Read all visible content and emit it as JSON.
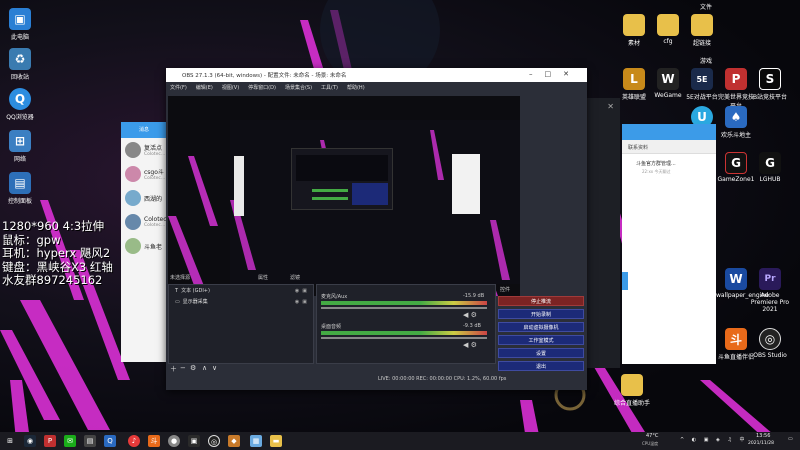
{
  "desktop_left": [
    {
      "label": "此电脑",
      "color": "#2a7fd4",
      "glyph": "▣"
    },
    {
      "label": "回收站",
      "color": "#3a7bb0",
      "glyph": "♻"
    },
    {
      "label": "QQ浏览器",
      "color": "#2c8de0",
      "glyph": "Q"
    },
    {
      "label": "网络",
      "color": "#3b7fc2",
      "glyph": "⊞"
    },
    {
      "label": "控制面板",
      "color": "#2d6fb8",
      "glyph": "▤"
    }
  ],
  "desktop_right_top": [
    {
      "label": "文件",
      "color": "#e8c04a",
      "glyph": "▬"
    },
    {
      "label": "素材",
      "color": "#e8c04a",
      "glyph": "▬"
    },
    {
      "label": "cfg",
      "color": "#e8c04a",
      "glyph": "▬"
    },
    {
      "label": "超链接",
      "color": "#e8c04a",
      "glyph": "▬"
    }
  ],
  "desktop_right_mid": [
    {
      "label": "游戏",
      "color": "#e8c04a",
      "glyph": "▬"
    },
    {
      "label": "英雄联盟",
      "color": "#c88a1a",
      "glyph": "L"
    },
    {
      "label": "WeGame",
      "color": "#222",
      "glyph": "W"
    },
    {
      "label": "5E对战平台",
      "color": "#1a2a4a",
      "glyph": "5E"
    },
    {
      "label": "完美世界竞技平台",
      "color": "#c03030",
      "glyph": "P"
    },
    {
      "label": "B站竞技平台",
      "color": "#0a0a0a",
      "glyph": "S"
    },
    {
      "label": "UU加速器",
      "color": "#2aa8e0",
      "glyph": "U"
    },
    {
      "label": "Steam",
      "color": "#1b2838",
      "glyph": "◉"
    },
    {
      "label": "欢乐斗地主",
      "color": "#2a6ac0",
      "glyph": "♠"
    },
    {
      "label": "GameZone1",
      "color": "#111",
      "glyph": "G"
    },
    {
      "label": "LGHUB",
      "color": "#111",
      "glyph": "G"
    },
    {
      "label": "wallpaper_engine",
      "color": "#1a4aa0",
      "glyph": "W"
    },
    {
      "label": "Adobe Premiere Pro 2021",
      "color": "#2a1a5a",
      "glyph": "Pr"
    },
    {
      "label": "斗鱼直播伴侣",
      "color": "#e86a1a",
      "glyph": "斗"
    },
    {
      "label": "OBS Studio",
      "color": "#222",
      "glyph": "◎"
    },
    {
      "label": "综合直播助手",
      "color": "#e8c04a",
      "glyph": "▬"
    }
  ],
  "overlay": {
    "line1": "1280*960 4:3拉伸",
    "line2": "鼠标：gpw",
    "line3": "耳机：hyperx 飓风2",
    "line4": "键盘：黑峡谷X3 红轴",
    "line5": "水友群897245162"
  },
  "chat": {
    "title": "消息",
    "items": [
      {
        "name": "复活点",
        "sub": "Colotec...",
        "color": "#888"
      },
      {
        "name": "csgo斗",
        "sub": "Colotec...",
        "color": "#c8a"
      },
      {
        "name": "西湖的",
        "sub": "",
        "color": "#7ac"
      },
      {
        "name": "Colotec",
        "sub": "Colotec...",
        "color": "#68a"
      },
      {
        "name": "斗鱼老",
        "sub": "",
        "color": "#9b8"
      }
    ]
  },
  "rpanel": {
    "header": "",
    "subheader": "联系资料",
    "item": "斗鱼官方群管理...",
    "item_sub": "22:xx 今天聊过"
  },
  "obs": {
    "title": "OBS 27.1.3 (64-bit, windows) - 配置文件: 未命名 - 场景: 未命名",
    "menu": [
      "文件(F)",
      "编辑(E)",
      "视图(V)",
      "停靠窗口(D)",
      "场景集合(S)",
      "工具(T)",
      "帮助(H)"
    ],
    "scenes_header": "未选择源",
    "props_label": "属性",
    "filters_label": "滤镜",
    "sources": [
      {
        "label": "文本 (GDI+)",
        "icon": "T"
      },
      {
        "label": "显示器采集",
        "icon": "▭"
      }
    ],
    "mixer": [
      {
        "label": "麦克风/Aux",
        "db": "-15.9 dB"
      },
      {
        "label": "桌面音频",
        "db": "-9.3 dB"
      }
    ],
    "controls_header": "控件",
    "buttons": [
      "停止推流",
      "开始录制",
      "启动虚拟摄像机",
      "工作室模式",
      "设置",
      "退出"
    ],
    "status": "LIVE: 00:00:00    REC: 00:00:00    CPU: 1.2%, 60.00 fps"
  },
  "taskbar": {
    "weather": "47°C",
    "weather_sub": "CPU温度",
    "time": "13:56",
    "date": "2021/11/28"
  }
}
